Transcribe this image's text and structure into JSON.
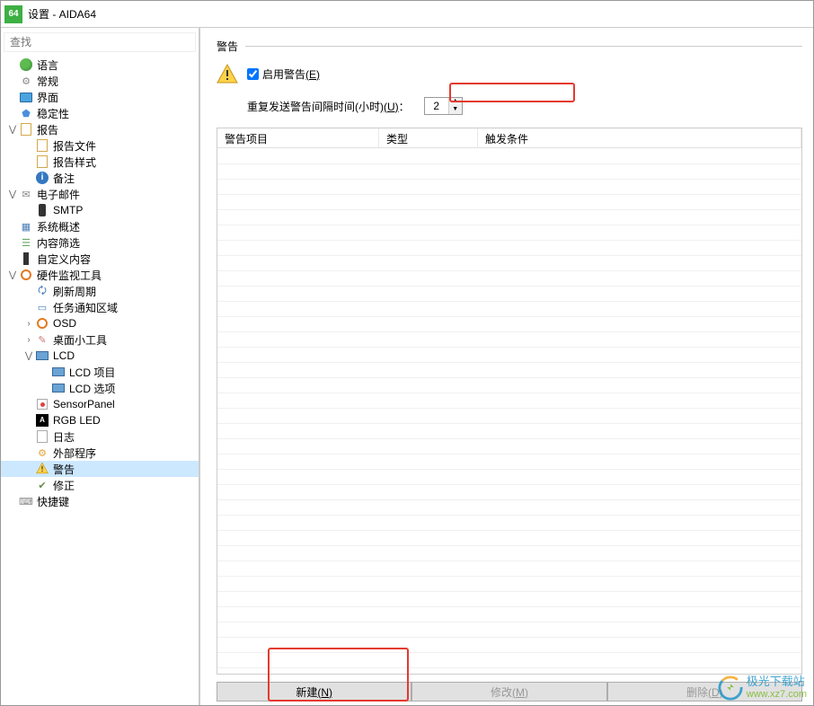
{
  "window": {
    "title": "设置 - AIDA64",
    "app_icon_text": "64"
  },
  "search": {
    "placeholder": "查找"
  },
  "tree": {
    "items": [
      {
        "label": "语言",
        "icon": "globe",
        "depth": 0,
        "expander": ""
      },
      {
        "label": "常规",
        "icon": "gear",
        "depth": 0,
        "expander": ""
      },
      {
        "label": "界面",
        "icon": "monitor",
        "depth": 0,
        "expander": ""
      },
      {
        "label": "稳定性",
        "icon": "shield",
        "depth": 0,
        "expander": ""
      },
      {
        "label": "报告",
        "icon": "doc",
        "depth": 0,
        "expander": "v"
      },
      {
        "label": "报告文件",
        "icon": "doc",
        "depth": 1,
        "expander": ""
      },
      {
        "label": "报告样式",
        "icon": "doc",
        "depth": 1,
        "expander": ""
      },
      {
        "label": "备注",
        "icon": "info",
        "depth": 1,
        "expander": ""
      },
      {
        "label": "电子邮件",
        "icon": "mail",
        "depth": 0,
        "expander": "v"
      },
      {
        "label": "SMTP",
        "icon": "phone",
        "depth": 1,
        "expander": ""
      },
      {
        "label": "系统概述",
        "icon": "list",
        "depth": 0,
        "expander": ""
      },
      {
        "label": "内容筛选",
        "icon": "filter",
        "depth": 0,
        "expander": ""
      },
      {
        "label": "自定义内容",
        "icon": "hw",
        "depth": 0,
        "expander": ""
      },
      {
        "label": "硬件监视工具",
        "icon": "circle",
        "depth": 0,
        "expander": "v"
      },
      {
        "label": "刷新周期",
        "icon": "refresh",
        "depth": 1,
        "expander": ""
      },
      {
        "label": "任务通知区域",
        "icon": "balloon",
        "depth": 1,
        "expander": ""
      },
      {
        "label": "OSD",
        "icon": "circle",
        "depth": 1,
        "expander": ">"
      },
      {
        "label": "桌面小工具",
        "icon": "paint",
        "depth": 1,
        "expander": ">"
      },
      {
        "label": "LCD",
        "icon": "lcd",
        "depth": 1,
        "expander": "v"
      },
      {
        "label": "LCD 项目",
        "icon": "lcd",
        "depth": 2,
        "expander": ""
      },
      {
        "label": "LCD 选项",
        "icon": "lcd",
        "depth": 2,
        "expander": ""
      },
      {
        "label": "SensorPanel",
        "icon": "sensor",
        "depth": 1,
        "expander": ""
      },
      {
        "label": "RGB LED",
        "icon": "rgb",
        "depth": 1,
        "expander": ""
      },
      {
        "label": "日志",
        "icon": "log",
        "depth": 1,
        "expander": ""
      },
      {
        "label": "外部程序",
        "icon": "ext",
        "depth": 1,
        "expander": ""
      },
      {
        "label": "警告",
        "icon": "warn",
        "depth": 1,
        "expander": "",
        "selected": true
      },
      {
        "label": "修正",
        "icon": "fix",
        "depth": 1,
        "expander": ""
      },
      {
        "label": "快捷键",
        "icon": "key",
        "depth": 0,
        "expander": ""
      }
    ]
  },
  "panel": {
    "section_title": "警告",
    "enable_checkbox_label": "启用警告",
    "enable_checkbox_accel": "(E)",
    "interval_label": "重复发送警告间隔时间(小时)",
    "interval_accel": "(U)",
    "interval_colon": "：",
    "interval_value": "2",
    "table": {
      "columns": [
        "警告项目",
        "类型",
        "触发条件"
      ]
    },
    "buttons": {
      "new": "新建",
      "new_accel": "(N)",
      "modify": "修改",
      "modify_accel": "(M)",
      "delete": "删除",
      "delete_accel": "(D)"
    }
  },
  "watermark": {
    "cn": "极光下载站",
    "url": "www.xz7.com"
  }
}
